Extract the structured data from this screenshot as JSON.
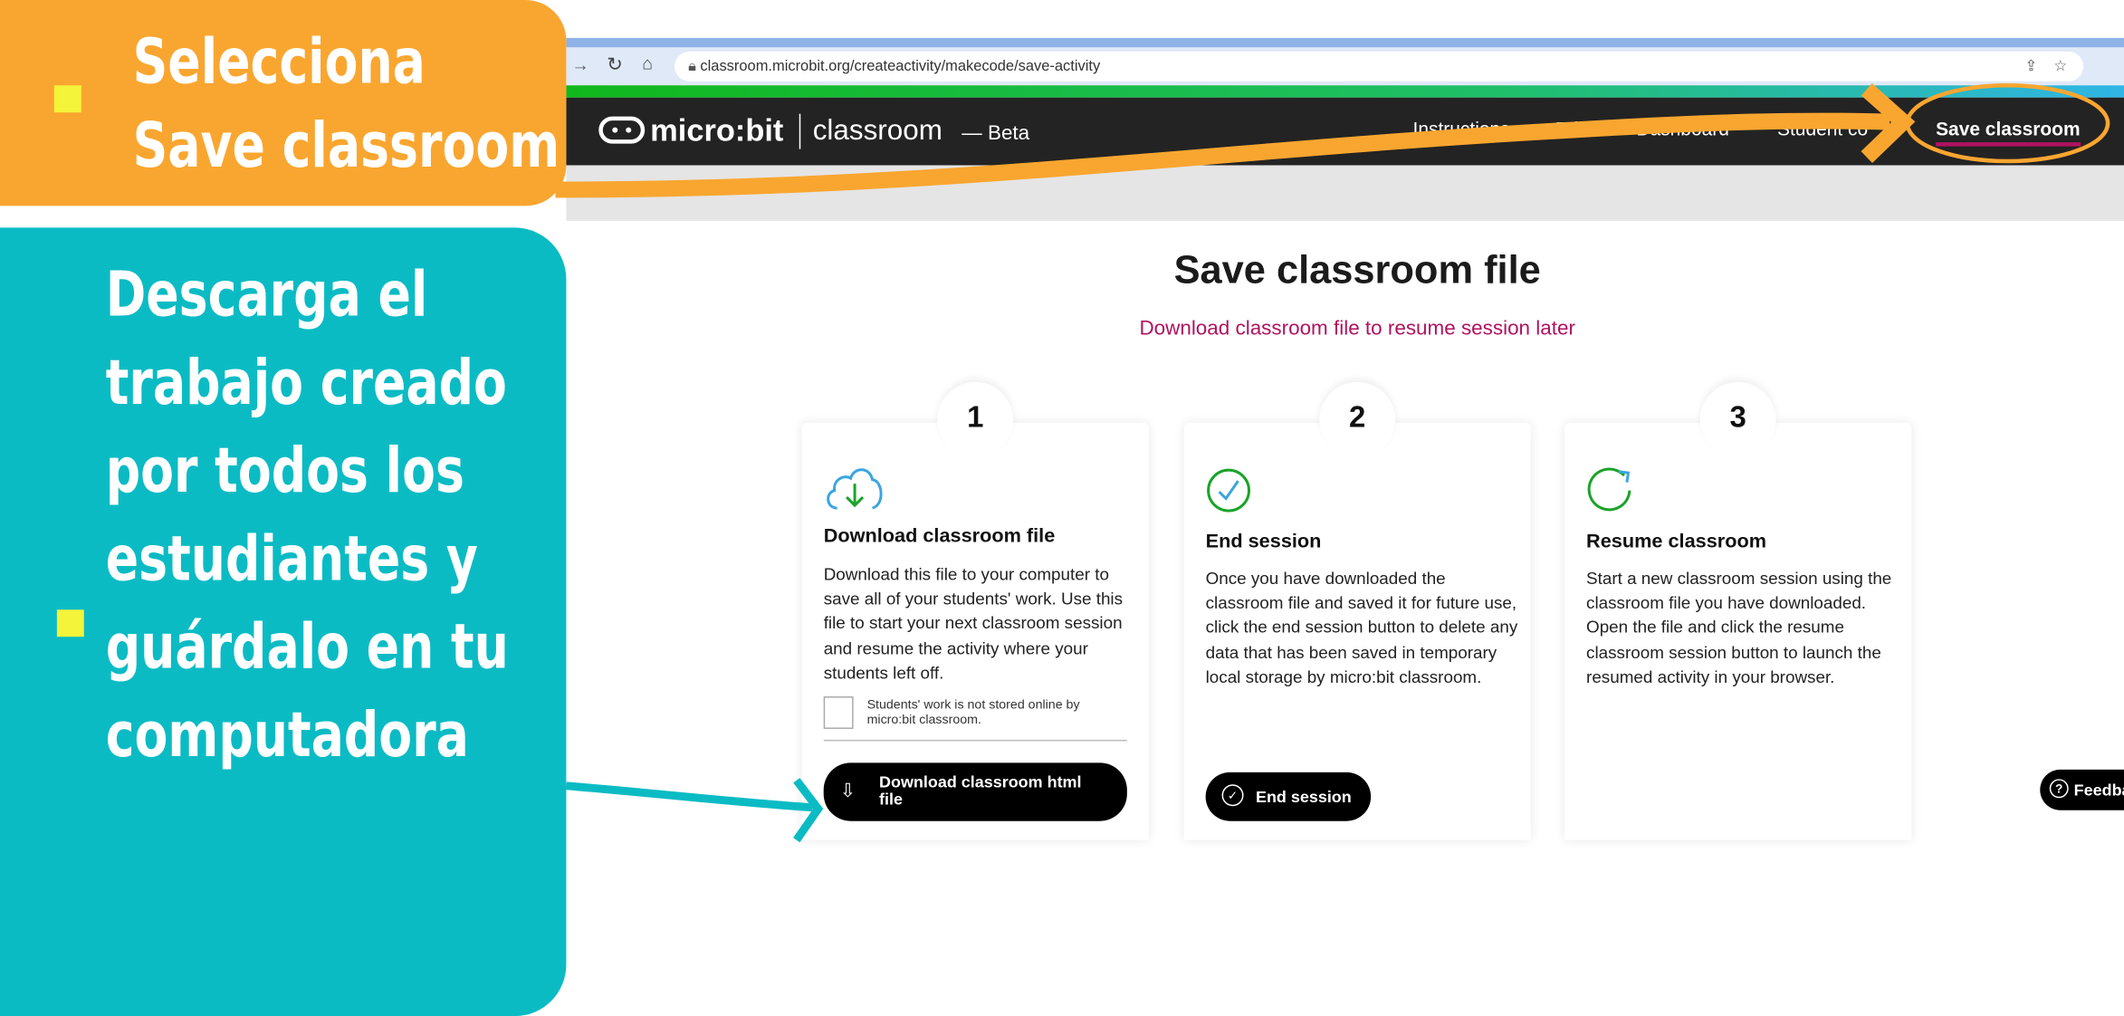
{
  "callouts": {
    "top": {
      "lines": [
        "Selecciona",
        "Save classroom"
      ],
      "color": "#F9A630"
    },
    "bottom": {
      "lines": [
        "Descarga el",
        "trabajo creado",
        "por todos los",
        "estudiantes y",
        "guárdalo en tu",
        "computadora"
      ],
      "color": "#0BBBC4"
    },
    "bullet_color": "#F4F43A"
  },
  "browser": {
    "url": "classroom.microbit.org/createactivity/makecode/save-activity"
  },
  "nav": {
    "logo": "micro:bit",
    "product": "classroom",
    "suffix": "— Beta",
    "items": [
      "Instructions",
      "Edit",
      "Dashboard",
      "Student co"
    ],
    "active": "Save classroom",
    "active_underline_color": "#B0125E"
  },
  "page": {
    "title": "Save classroom file",
    "subtitle": "Download classroom file to resume session later",
    "subtitle_color": "#B0125E"
  },
  "cards": [
    {
      "number": "1",
      "icon": "cloud-download-icon",
      "title": "Download classroom file",
      "body": "Download this file to your computer to save all of your students' work. Use this file to start your next classroom session and resume the activity where your students left off.",
      "note": "Students' work is not stored online by micro:bit classroom.",
      "button": "Download classroom html file"
    },
    {
      "number": "2",
      "icon": "check-circle-icon",
      "title": "End session",
      "body": "Once you have downloaded the classroom file and saved it for future use, click the end session button to delete any data that has been saved in temporary local storage by micro:bit classroom.",
      "button": "End session"
    },
    {
      "number": "3",
      "icon": "refresh-icon",
      "title": "Resume classroom",
      "body": "Start a new classroom session using the classroom file you have downloaded. Open the file and click the resume classroom session button to launch the resumed activity in your browser."
    }
  ],
  "feedback": "Feedba"
}
